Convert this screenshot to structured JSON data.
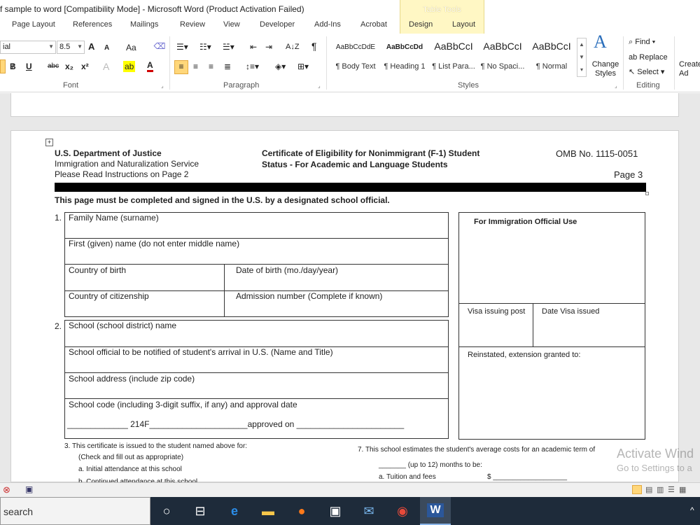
{
  "window": {
    "title": "f sample to word [Compatibility Mode]  -  Microsoft Word (Product Activation Failed)",
    "contextual_group": "Table Tools"
  },
  "tabs": [
    "Page Layout",
    "References",
    "Mailings",
    "Review",
    "View",
    "Developer",
    "Add-Ins",
    "Acrobat",
    "Design",
    "Layout"
  ],
  "ribbon": {
    "font": {
      "font_name": "ial",
      "font_size": "8.5",
      "group_label": "Font",
      "grow_font": "A",
      "shrink_font": "A",
      "change_case": "Aa",
      "bold": "B",
      "italic": "I",
      "underline": "U",
      "strikethrough": "abc",
      "subscript": "x₂",
      "superscript": "x²",
      "text_effects": "A",
      "highlight": "ab",
      "font_color": "A"
    },
    "paragraph": {
      "group_label": "Paragraph",
      "sort": "A↓Z",
      "show_marks": "¶"
    },
    "styles": {
      "group_label": "Styles",
      "items": [
        {
          "preview": "AaBbCcDdE",
          "name": "¶ Body Text"
        },
        {
          "preview": "AaBbCcDd",
          "name": "¶ Heading 1"
        },
        {
          "preview": "AaBbCcI",
          "name": "¶ List Para..."
        },
        {
          "preview": "AaBbCcI",
          "name": "¶ No Spaci..."
        },
        {
          "preview": "AaBbCcI",
          "name": "¶ Normal"
        }
      ],
      "change_styles": "Change Styles"
    },
    "editing": {
      "group_label": "Editing",
      "find": "Find",
      "replace": "Replace",
      "select": "Select",
      "create": "Create Ad"
    }
  },
  "form": {
    "header_left_1": "U.S. Department of Justice",
    "header_left_2": "Immigration and Naturalization Service",
    "header_left_3": "Please Read Instructions on Page 2",
    "header_center_1": "Certificate of Eligibility for Nonimmigrant (F-1) Student",
    "header_center_2": "Status - For Academic and Language Students",
    "omb": "OMB No. 1115-0051",
    "page_no": "Page 3",
    "instruction": "This page must be completed and signed in the U.S. by a designated school official.",
    "sec1_num": "1.",
    "family_name": "Family Name (surname)",
    "first_name": "First (given) name (do not enter middle name)",
    "country_birth": "Country of birth",
    "dob": "Date of birth (mo./day/year)",
    "country_citizenship": "Country of citizenship",
    "admission": "Admission number (Complete if known)",
    "sec2_num": "2.",
    "school_name": "School (school district) name",
    "school_official": "School official to be notified of student's arrival in U.S. (Name and Title)",
    "school_address": "School address (include zip code)",
    "school_code": "School code (including 3-digit suffix, if any) and approval date",
    "code_line": "_____________ 214F_____________________approved on _______________________",
    "immigration_use": "For Immigration Official Use",
    "visa_post": "Visa issuing post",
    "date_visa": "Date Visa issued",
    "reinstated": "Reinstated, extension granted to:",
    "sec3": "3.    This certificate is issued to the student named above for:",
    "sec3_sub": "(Check and fill out as appropriate)",
    "sec3_a": "a.       Initial attendance at this school",
    "sec3_b": "b.       Continued attendance at this school",
    "sec7": "7.   This school estimates the student's average costs for an academic term of",
    "sec7_months": "_______ (up to 12) months to be:",
    "sec7_a": "a.    Tuition and fees",
    "sec7_a_amt": "$ ___________________"
  },
  "watermark": {
    "line1": "Activate Wind",
    "line2": "Go to Settings to a"
  },
  "taskbar": {
    "search": "search"
  }
}
